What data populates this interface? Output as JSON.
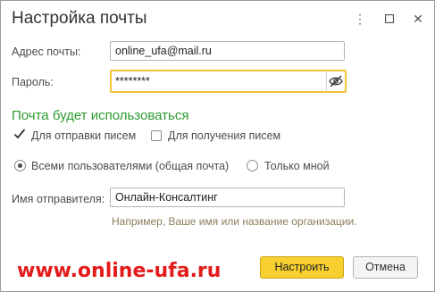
{
  "window": {
    "title": "Настройка почты",
    "more_icon": "⋮",
    "maximize_icon": "☐",
    "close_icon": "✕"
  },
  "email": {
    "label": "Адрес почты:",
    "value": "online_ufa@mail.ru"
  },
  "password": {
    "label": "Пароль:",
    "value": "********",
    "toggle_icon": "eye-slash-icon"
  },
  "usage": {
    "heading": "Почта будет использоваться",
    "send_label": "Для отправки писем",
    "send_checked": true,
    "receive_label": "Для получения писем",
    "receive_checked": false
  },
  "access": {
    "all_users_label": "Всеми пользователями (общая почта)",
    "only_me_label": "Только мной",
    "selected": "all_users"
  },
  "sender": {
    "label": "Имя отправителя:",
    "value": "Онлайн-Консалтинг",
    "hint": "Например, Ваше имя или название организации."
  },
  "watermark": "www.online-ufa.ru",
  "buttons": {
    "configure": "Настроить",
    "cancel": "Отмена"
  },
  "colors": {
    "accent_green": "#2b9b2e",
    "primary_button": "#f7cf2e",
    "focus_border": "#f0c23a",
    "watermark_red": "#e31b1b"
  }
}
